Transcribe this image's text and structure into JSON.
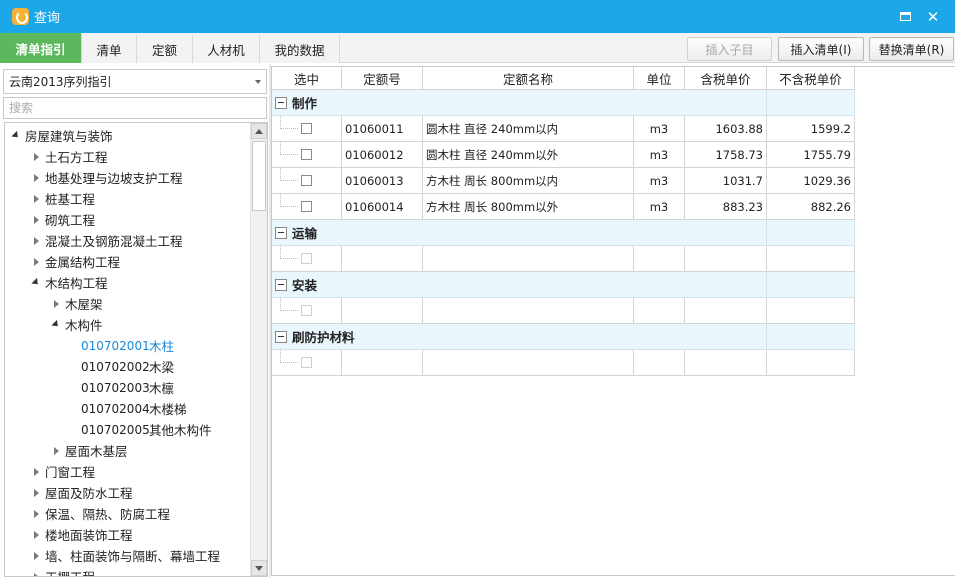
{
  "window": {
    "title": "查询",
    "maximize_icon": "maximize-icon",
    "close_label": "✕"
  },
  "tabs": [
    {
      "label": "清单指引",
      "active": true
    },
    {
      "label": "清单",
      "active": false
    },
    {
      "label": "定额",
      "active": false
    },
    {
      "label": "人材机",
      "active": false
    },
    {
      "label": "我的数据",
      "active": false
    }
  ],
  "toolbar": {
    "insert_child": "插入子目",
    "insert_list": "插入清单(I)",
    "replace_list": "替换清单(R)"
  },
  "left": {
    "dropdown_value": "云南2013序列指引",
    "search_placeholder": "搜索",
    "tree": [
      {
        "label": "房屋建筑与装饰",
        "arrow": "open"
      },
      {
        "label": "土石方工程",
        "arrow": "closed"
      },
      {
        "label": "地基处理与边坡支护工程",
        "arrow": "closed"
      },
      {
        "label": "桩基工程",
        "arrow": "closed"
      },
      {
        "label": "砌筑工程",
        "arrow": "closed"
      },
      {
        "label": "混凝土及钢筋混凝土工程",
        "arrow": "closed"
      },
      {
        "label": "金属结构工程",
        "arrow": "closed"
      },
      {
        "label": "木结构工程",
        "arrow": "open"
      },
      {
        "label": "木屋架",
        "arrow": "closed"
      },
      {
        "label": "木构件",
        "arrow": "open"
      },
      {
        "code": "010702001",
        "label": "木柱",
        "selected": true
      },
      {
        "code": "010702002",
        "label": "木梁"
      },
      {
        "code": "010702003",
        "label": "木檩"
      },
      {
        "code": "010702004",
        "label": "木楼梯"
      },
      {
        "code": "010702005",
        "label": "其他木构件"
      },
      {
        "label": "屋面木基层",
        "arrow": "closed"
      },
      {
        "label": "门窗工程",
        "arrow": "closed"
      },
      {
        "label": "屋面及防水工程",
        "arrow": "closed"
      },
      {
        "label": "保温、隔热、防腐工程",
        "arrow": "closed"
      },
      {
        "label": "楼地面装饰工程",
        "arrow": "closed"
      },
      {
        "label": "墙、柱面装饰与隔断、幕墙工程",
        "arrow": "closed"
      },
      {
        "label": "天棚工程",
        "arrow": "closed"
      }
    ]
  },
  "grid": {
    "headers": [
      "选中",
      "定额号",
      "定额名称",
      "单位",
      "含税单价",
      "不含税单价"
    ],
    "groups": [
      {
        "title": "制作",
        "rows": [
          {
            "code": "01060011",
            "name": "圆木柱 直径 240mm以内",
            "unit": "m3",
            "tax_price": "1603.88",
            "notax_price": "1599.2"
          },
          {
            "code": "01060012",
            "name": "圆木柱 直径 240mm以外",
            "unit": "m3",
            "tax_price": "1758.73",
            "notax_price": "1755.79"
          },
          {
            "code": "01060013",
            "name": "方木柱 周长 800mm以内",
            "unit": "m3",
            "tax_price": "1031.7",
            "notax_price": "1029.36"
          },
          {
            "code": "01060014",
            "name": "方木柱 周长 800mm以外",
            "unit": "m3",
            "tax_price": "883.23",
            "notax_price": "882.26"
          }
        ]
      },
      {
        "title": "运输",
        "rows": [
          {
            "code": "",
            "name": "",
            "unit": "",
            "tax_price": "",
            "notax_price": "",
            "empty": true
          }
        ]
      },
      {
        "title": "安装",
        "rows": [
          {
            "code": "",
            "name": "",
            "unit": "",
            "tax_price": "",
            "notax_price": "",
            "empty": true
          }
        ]
      },
      {
        "title": "刷防护材料",
        "rows": [
          {
            "code": "",
            "name": "",
            "unit": "",
            "tax_price": "",
            "notax_price": "",
            "empty": true
          }
        ]
      }
    ]
  },
  "colors": {
    "titlebar": "#1ba7e8",
    "active_tab": "#5cb85c",
    "selected_tree_item": "#1b8ad6",
    "group_row": "#e9f6fc"
  }
}
